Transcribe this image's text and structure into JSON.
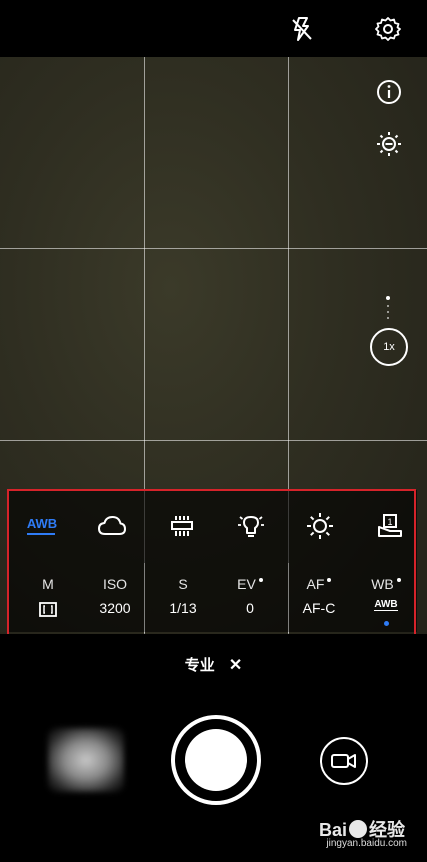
{
  "top": {
    "icons": [
      "flash-off-icon",
      "settings-gear-icon"
    ]
  },
  "side": {
    "icons": [
      "info-icon",
      "exposure-adjust-icon"
    ],
    "zoom_label": "1x"
  },
  "wb_presets": [
    {
      "label": "AWB",
      "selected": true,
      "color": "#2f7cf6"
    },
    {
      "icon": "cloudy-icon"
    },
    {
      "icon": "fluorescent-icon"
    },
    {
      "icon": "incandescent-bulb-icon"
    },
    {
      "icon": "sunny-icon"
    },
    {
      "icon": "custom-wb-icon",
      "badge": "1"
    }
  ],
  "params": [
    {
      "label": "M",
      "value": "metering-icon"
    },
    {
      "label": "ISO",
      "value": "3200"
    },
    {
      "label": "S",
      "value": "1/13"
    },
    {
      "label": "EV",
      "value": "0",
      "dot": true
    },
    {
      "label": "AF",
      "value": "AF-C",
      "dot": true
    },
    {
      "label": "WB",
      "value": "AWB",
      "dot": true,
      "active": true
    }
  ],
  "mode": {
    "label": "专业",
    "close": "✕"
  },
  "watermark": {
    "brand": "Bai",
    "brand2": "经验",
    "url": "jingyan.baidu.com"
  },
  "colors": {
    "accent": "#2f7cf6",
    "highlight_box": "#d6232a"
  }
}
